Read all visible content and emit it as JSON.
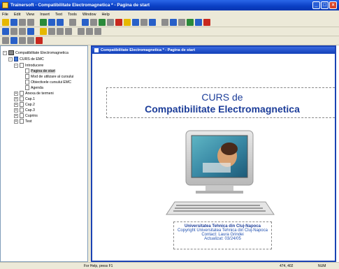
{
  "window": {
    "title": "Trainersoft - Compatibilitate Electromagnetica * - Pagina de start",
    "minimize": "_",
    "maximize": "□",
    "close": "×"
  },
  "menu": [
    "File",
    "Edit",
    "View",
    "Insert",
    "Text",
    "Tools",
    "Window",
    "Help"
  ],
  "toolbar_colors": {
    "icon_yellow": "#e6b800",
    "icon_blue": "#2860c8",
    "icon_red": "#c8281e",
    "icon_green": "#2a8a3a",
    "icon_gray": "#8c8c8c"
  },
  "tree": {
    "root": "Compatibilitate Electromagnetica",
    "course": "CURS de EMC",
    "introducere": "Introducere",
    "items": [
      "Pagina de start",
      "Mod de utilizare al cursului",
      "Obiectivele cursului EMC",
      "Agenda"
    ],
    "sections": [
      "Anexa de termeni",
      "Cap.1",
      "Cap.2",
      "Cap.3",
      "Cuprins",
      "Test"
    ],
    "expand_plus": "+",
    "expand_minus": "−"
  },
  "document": {
    "header": "Compatibilitate Electromagnetica * - Pagina de start",
    "title_line1": "CURS de",
    "title_line2": "Compatibilitate Electromagnetica",
    "university": "Universitatea Tehnica din Cluj-Napoca",
    "copyright": "Copyright Universitatea Tehnica din Cluj-Napoca",
    "contact": "Contact: Laura Grindei",
    "updated": "Actualizat: 03/24/05"
  },
  "status": {
    "help": "For Help, press F1",
    "coords": "474, 402",
    "num": "NUM"
  }
}
